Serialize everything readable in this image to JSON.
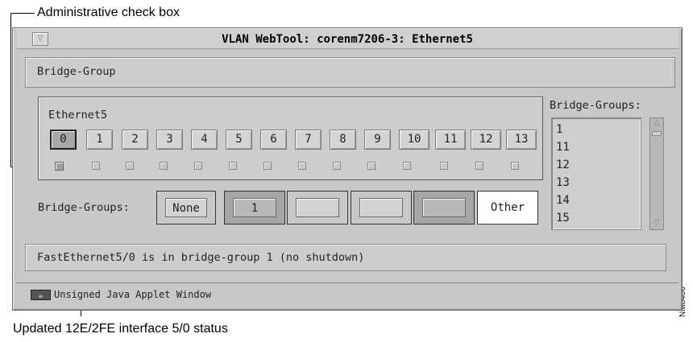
{
  "annotations": {
    "top": "Administrative check box",
    "bottom": "Updated 12E/2FE interface 5/0 status",
    "side_id": "NM6406"
  },
  "window": {
    "title": "VLAN WebTool: corenm7206-3: Ethernet5",
    "footer": "Unsigned Java Applet Window"
  },
  "bridge_group_header": "Bridge-Group",
  "ethernet": {
    "label": "Ethernet5",
    "ports": [
      "0",
      "1",
      "2",
      "3",
      "4",
      "5",
      "6",
      "7",
      "8",
      "9",
      "10",
      "11",
      "12",
      "13"
    ],
    "selected_port": "0"
  },
  "bridge_groups_row": {
    "label": "Bridge-Groups:",
    "buttons": [
      "None",
      "1",
      "",
      "",
      "",
      "Other"
    ]
  },
  "bridge_groups_list": {
    "label": "Bridge-Groups:",
    "items": [
      "1",
      "11",
      "12",
      "13",
      "14",
      "15"
    ]
  },
  "status": "FastEthernet5/0 is in bridge-group 1 (no shutdown)"
}
